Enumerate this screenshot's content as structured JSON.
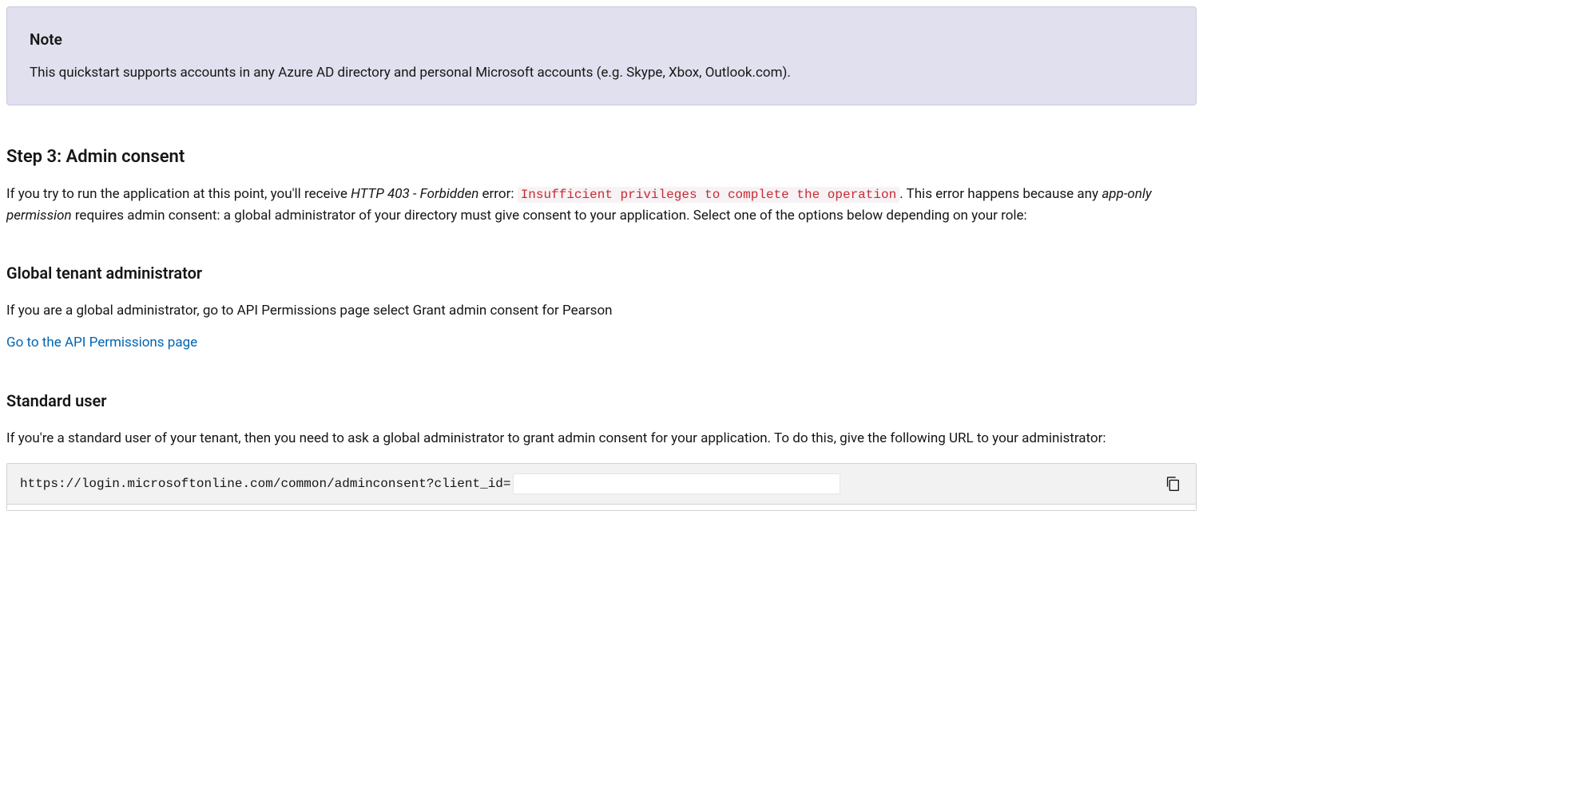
{
  "note": {
    "title": "Note",
    "body": "This quickstart supports accounts in any Azure AD directory and personal Microsoft accounts (e.g. Skype, Xbox, Outlook.com)."
  },
  "step3": {
    "heading": "Step 3: Admin consent",
    "para_part1": "If you try to run the application at this point, you'll receive ",
    "http_error": "HTTP 403 - Forbidden",
    "para_part2": " error: ",
    "inline_code": "Insufficient privileges to complete the operation",
    "para_part3": ". This error happens because any ",
    "app_only": "app-only permission",
    "para_part4": " requires admin consent: a global administrator of your directory must give consent to your application. Select one of the options below depending on your role:"
  },
  "global_admin": {
    "heading": "Global tenant administrator",
    "body": "If you are a global administrator, go to API Permissions page select Grant admin consent for Pearson",
    "link_text": "Go to the API Permissions page"
  },
  "standard_user": {
    "heading": "Standard user",
    "body": "If you're a standard user of your tenant, then you need to ask a global administrator to grant admin consent for your application. To do this, give the following URL to your administrator:",
    "code_url": "https://login.microsoftonline.com/common/adminconsent?client_id="
  }
}
